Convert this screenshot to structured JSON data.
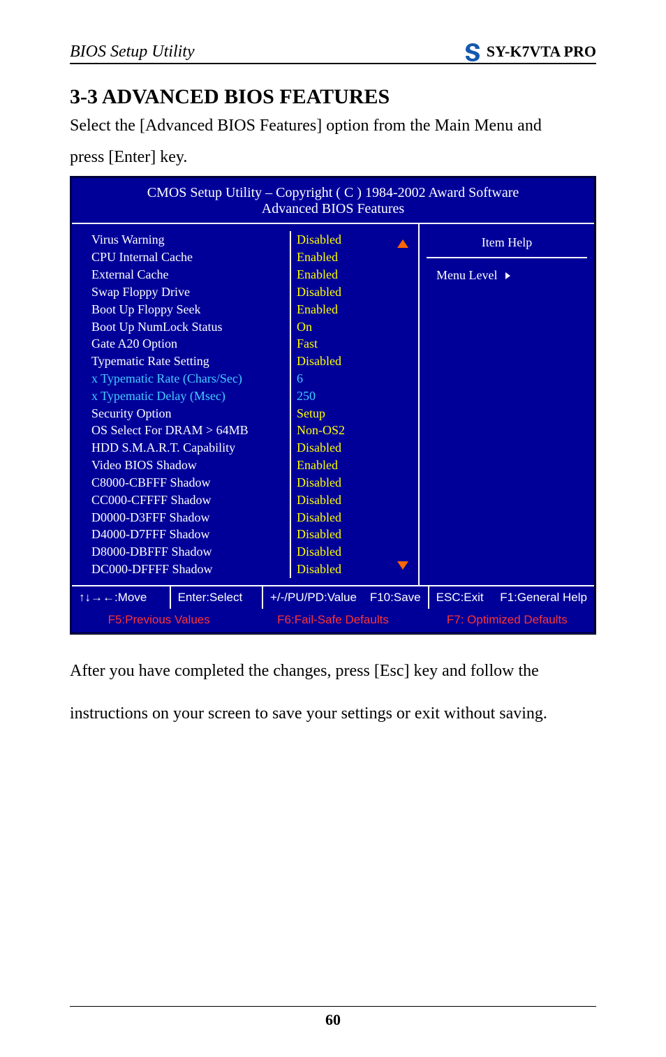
{
  "header": {
    "left": "BIOS Setup Utility",
    "right": "SY-K7VTA PRO"
  },
  "section_heading": "3-3  ADVANCED BIOS FEATURES",
  "intro_line1": "Select the [Advanced BIOS Features] option from the Main Menu and",
  "intro_line2": "press [Enter] key.",
  "bios": {
    "title_line1": "CMOS Setup Utility – Copyright ( C ) 1984-2002 Award Software",
    "title_line2": "Advanced BIOS Features",
    "rows": [
      {
        "label": "Virus Warning",
        "value": "Disabled",
        "label_class": "",
        "value_class": "yellow"
      },
      {
        "label": "CPU Internal Cache",
        "value": "Enabled",
        "label_class": "",
        "value_class": "yellow"
      },
      {
        "label": "External Cache",
        "value": "Enabled",
        "label_class": "",
        "value_class": "yellow"
      },
      {
        "label": "Swap Floppy Drive",
        "value": "Disabled",
        "label_class": "",
        "value_class": "yellow"
      },
      {
        "label": "Boot Up Floppy Seek",
        "value": "Enabled",
        "label_class": "",
        "value_class": "yellow"
      },
      {
        "label": "Boot Up NumLock Status",
        "value": "On",
        "label_class": "",
        "value_class": "yellow"
      },
      {
        "label": "Gate A20 Option",
        "value": "Fast",
        "label_class": "",
        "value_class": "yellow"
      },
      {
        "label": "Typematic Rate Setting",
        "value": "Disabled",
        "label_class": "",
        "value_class": "yellow"
      },
      {
        "label": "x Typematic Rate (Chars/Sec)",
        "value": "6",
        "label_class": "cyan",
        "value_class": "cyan"
      },
      {
        "label": "x Typematic Delay (Msec)",
        "value": "250",
        "label_class": "cyan",
        "value_class": "cyan"
      },
      {
        "label": "Security Option",
        "value": "Setup",
        "label_class": "",
        "value_class": "yellow"
      },
      {
        "label": "OS Select For DRAM > 64MB",
        "value": "Non-OS2",
        "label_class": "",
        "value_class": "yellow"
      },
      {
        "label": "HDD S.M.A.R.T. Capability",
        "value": "Disabled",
        "label_class": "",
        "value_class": "yellow"
      },
      {
        "label": "Video BIOS Shadow",
        "value": "Enabled",
        "label_class": "",
        "value_class": "yellow"
      },
      {
        "label": "C8000-CBFFF Shadow",
        "value": "Disabled",
        "label_class": "",
        "value_class": "yellow"
      },
      {
        "label": "CC000-CFFFF Shadow",
        "value": "Disabled",
        "label_class": "",
        "value_class": "yellow"
      },
      {
        "label": "D0000-D3FFF Shadow",
        "value": "Disabled",
        "label_class": "",
        "value_class": "yellow"
      },
      {
        "label": "D4000-D7FFF Shadow",
        "value": "Disabled",
        "label_class": "",
        "value_class": "yellow"
      },
      {
        "label": "D8000-DBFFF Shadow",
        "value": "Disabled",
        "label_class": "",
        "value_class": "yellow"
      },
      {
        "label": "DC000-DFFFF Shadow",
        "value": "Disabled",
        "label_class": "",
        "value_class": "yellow"
      }
    ],
    "help_title": "Item Help",
    "menu_level": "Menu Level",
    "footer": {
      "move": "↑↓→←:Move",
      "select": "Enter:Select",
      "value": "+/-/PU/PD:Value",
      "save": "F10:Save",
      "exit": "ESC:Exit",
      "help": "F1:General Help",
      "prev": "F5:Previous Values",
      "fail": "F6:Fail-Safe Defaults",
      "opt": "F7: Optimized Defaults"
    }
  },
  "after_line1": "After you have completed the changes, press [Esc] key and follow the",
  "after_line2": "instructions on your screen to save your settings or exit without saving.",
  "page_number": "60"
}
